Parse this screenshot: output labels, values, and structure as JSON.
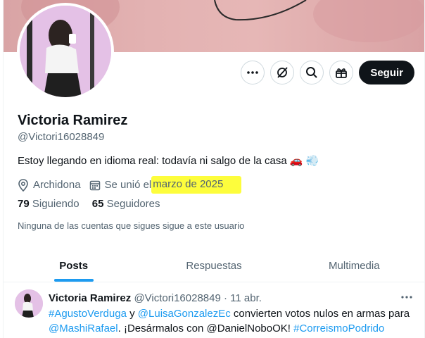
{
  "profile": {
    "name": "Victoria Ramirez",
    "handle": "@Victori16028849",
    "bio_text": "Estoy llegando en idioma real: todavía ni salgo de la casa",
    "bio_emoji": "🚗 💨",
    "location": "Archidona",
    "joined_prefix": "Se unió el",
    "joined_date": "marzo de 2025",
    "following_count": "79",
    "following_label": "Siguiendo",
    "followers_count": "65",
    "followers_label": "Seguidores",
    "no_follow_note": "Ninguna de las cuentas que sigues sigue a este usuario"
  },
  "actions": {
    "more_icon": "more-icon",
    "grok_icon": "grok-icon",
    "search_icon": "search-icon",
    "gift_icon": "gift-icon",
    "follow_label": "Seguir"
  },
  "tabs": [
    {
      "label": "Posts",
      "active": true
    },
    {
      "label": "Respuestas",
      "active": false
    },
    {
      "label": "Multimedia",
      "active": false
    }
  ],
  "tweet": {
    "author": "Victoria Ramirez",
    "handle": "@Victori16028849",
    "date": "· 11 abr.",
    "tag1": "#AgustoVerduga",
    "y": " y ",
    "mention1": "@LuisaGonzalezEc",
    "text1": " convierten votos nulos en armas para ",
    "mention2": "@MashiRafael",
    "text2": ". ¡Desármalos con @DanielNoboOK! ",
    "tag2": "#CorreismoPodrido"
  },
  "colors": {
    "accent": "#1d9bf0",
    "highlight": "#fdfd3c",
    "follow_bg": "#0f1419"
  }
}
